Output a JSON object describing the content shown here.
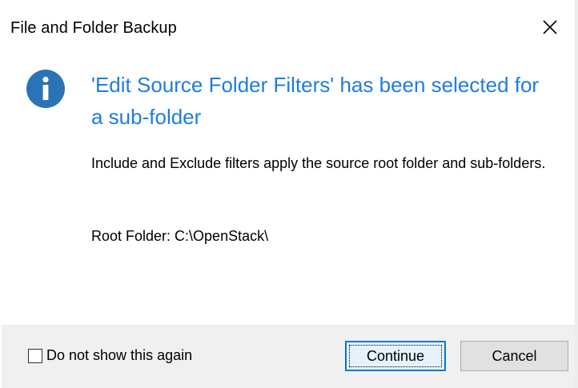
{
  "window": {
    "title": "File and Folder Backup",
    "close_label": "Close"
  },
  "message": {
    "icon": "info-icon",
    "heading": "'Edit Source Folder Filters' has been selected for a sub-folder",
    "body": "Include and Exclude filters apply the source root folder and sub-folders.",
    "root_folder": "Root Folder: C:\\OpenStack\\"
  },
  "footer": {
    "checkbox_label": "Do not show this again",
    "checkbox_checked": false,
    "continue_label": "Continue",
    "cancel_label": "Cancel"
  },
  "colors": {
    "heading": "#1e7de0",
    "info_icon": "#2b73b7",
    "footer_bg": "#f0f0f0",
    "default_button_border": "#0078d7"
  }
}
